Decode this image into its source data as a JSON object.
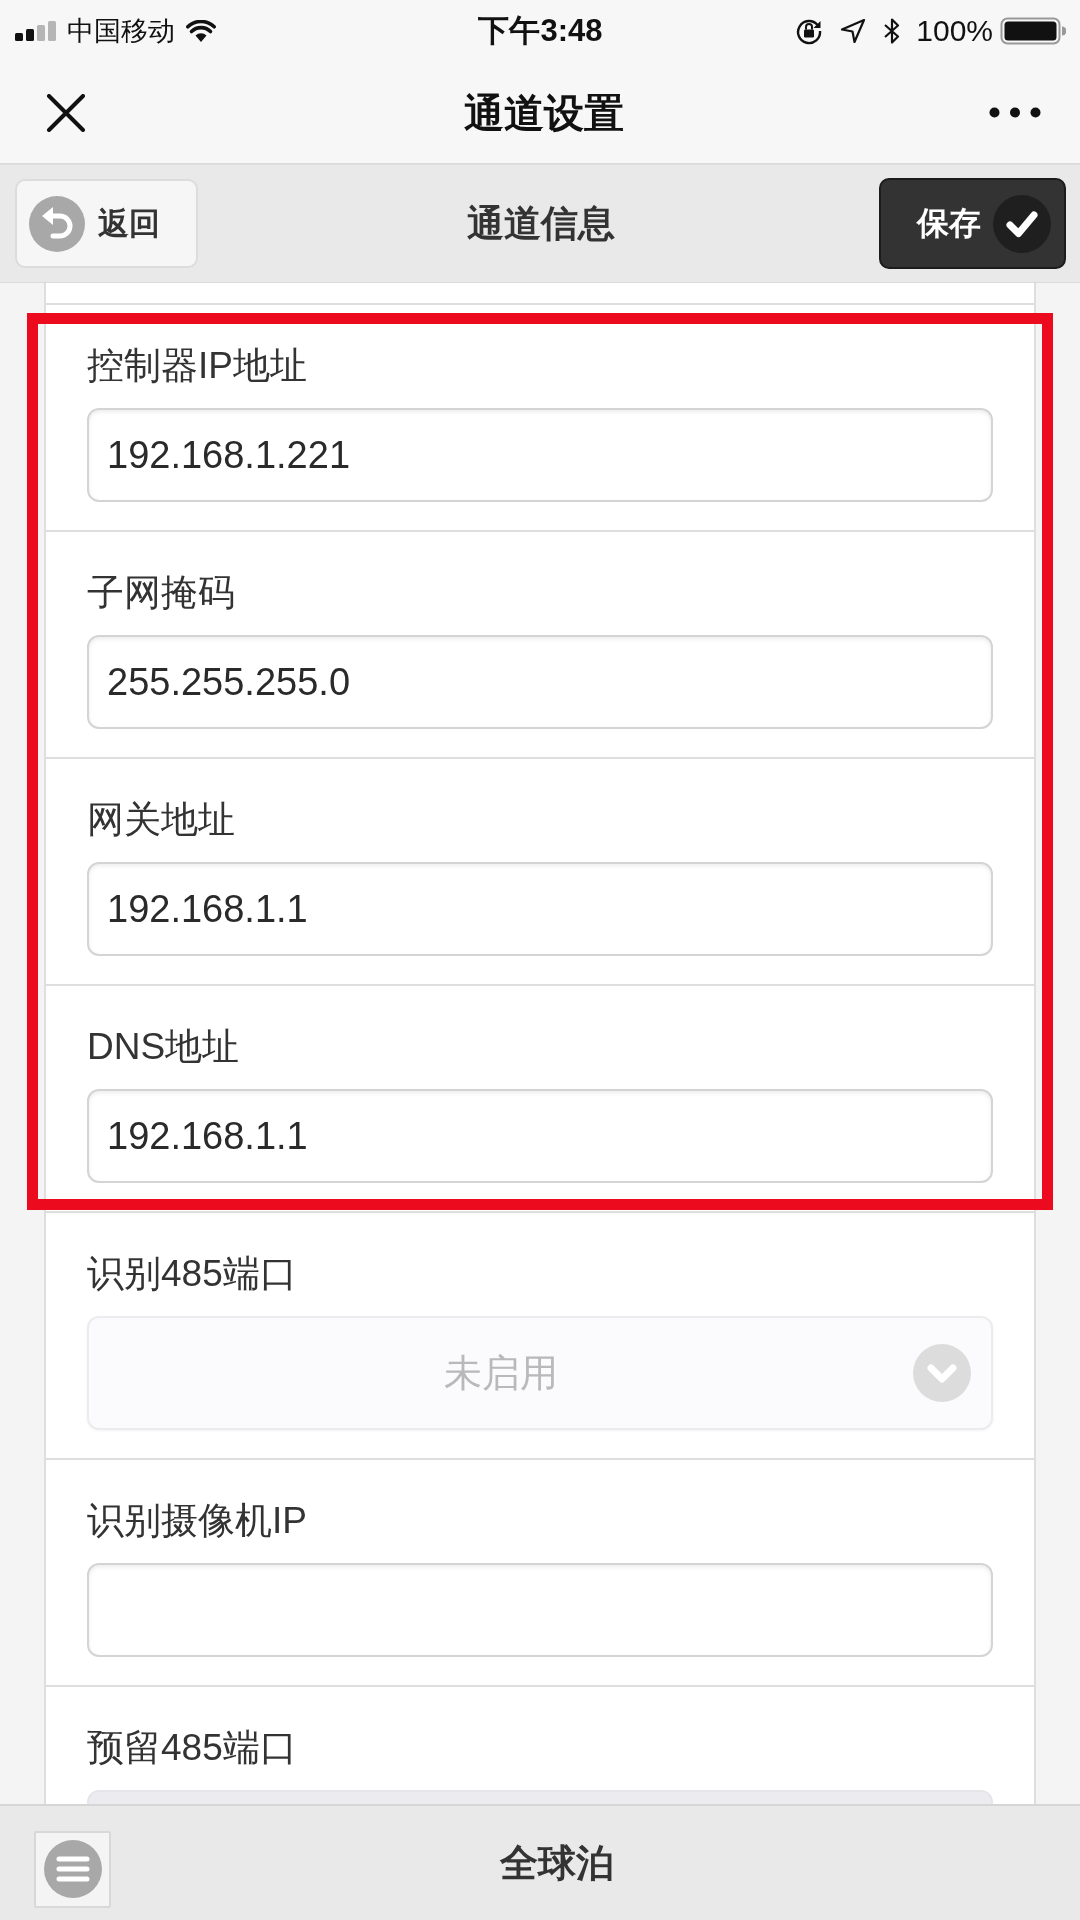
{
  "status_bar": {
    "carrier": "中国移动",
    "time": "下午3:48",
    "battery": "100%"
  },
  "title_bar": {
    "title": "通道设置"
  },
  "toolbar": {
    "back_button": "返回",
    "title": "通道信息",
    "save_button": "保存"
  },
  "fields": [
    {
      "label": "控制器IP地址",
      "kind": "input",
      "value": "192.168.1.221",
      "disabled": false,
      "highlighted": true
    },
    {
      "label": "子网掩码",
      "kind": "input",
      "value": "255.255.255.0",
      "disabled": false,
      "highlighted": true
    },
    {
      "label": "网关地址",
      "kind": "input",
      "value": "192.168.1.1",
      "disabled": false,
      "highlighted": true
    },
    {
      "label": "DNS地址",
      "kind": "input",
      "value": "192.168.1.1",
      "disabled": false,
      "highlighted": true
    },
    {
      "label": "识别485端口",
      "kind": "select",
      "value": "未启用",
      "disabled": true,
      "highlighted": false
    },
    {
      "label": "识别摄像机IP",
      "kind": "input",
      "disabled": false,
      "highlighted": false
    },
    {
      "label": "预留485端口",
      "kind": "input",
      "disabled": true,
      "highlighted": false
    }
  ],
  "footer": {
    "title": "全球泊"
  }
}
